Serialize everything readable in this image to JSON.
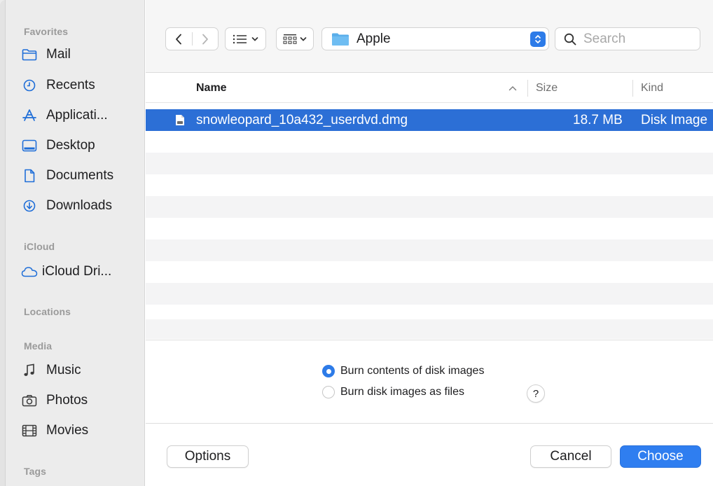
{
  "sidebar": {
    "sections": {
      "favorites": "Favorites",
      "icloud": "iCloud",
      "locations": "Locations",
      "media": "Media",
      "tags": "Tags"
    },
    "items": [
      {
        "label": "Mail",
        "icon": "folder-icon"
      },
      {
        "label": "Recents",
        "icon": "clock-icon"
      },
      {
        "label": "Applicati...",
        "icon": "applications-icon"
      },
      {
        "label": "Desktop",
        "icon": "desktop-icon"
      },
      {
        "label": "Documents",
        "icon": "document-icon"
      },
      {
        "label": "Downloads",
        "icon": "download-icon"
      },
      {
        "label": "iCloud Dri...",
        "icon": "cloud-icon"
      },
      {
        "label": "Music",
        "icon": "music-note-icon"
      },
      {
        "label": "Photos",
        "icon": "camera-icon"
      },
      {
        "label": "Movies",
        "icon": "film-icon"
      }
    ]
  },
  "toolbar": {
    "path_label": "Apple",
    "search_placeholder": "Search"
  },
  "columns": {
    "name": "Name",
    "size": "Size",
    "kind": "Kind"
  },
  "files": [
    {
      "name": "snowleopard_10a432_userdvd.dmg",
      "size": "18.7 MB",
      "kind": "Disk Image",
      "selected": true
    }
  ],
  "options": {
    "burn_contents": "Burn contents of disk images",
    "burn_as_files": "Burn disk images as files",
    "selected_option": "Burn contents of disk images",
    "help": "?"
  },
  "buttons": {
    "options": "Options",
    "cancel": "Cancel",
    "choose": "Choose"
  },
  "colors": {
    "accent": "#2f7ef0",
    "selection": "#2c6fd6",
    "sidebar_bg": "#ececec"
  }
}
